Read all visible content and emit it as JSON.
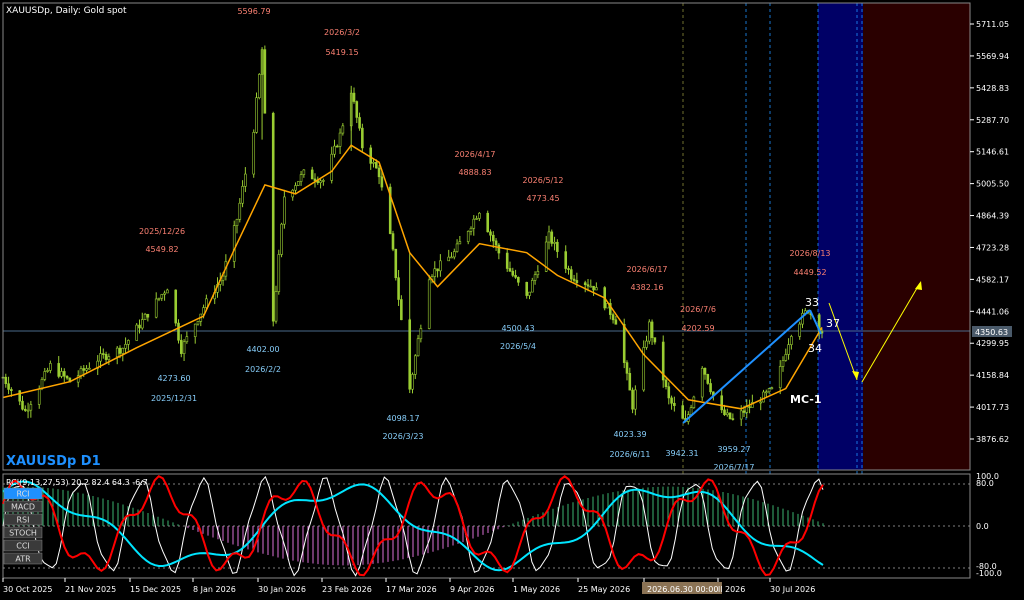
{
  "symbol_header": "XAUUSDp, Daily:  Gold spot",
  "symbol_big": "XAUUSDp D1",
  "current_price_label": "4350.63",
  "mc_label": "MC-1",
  "wave_labels": [
    "33",
    "34",
    "37"
  ],
  "indicator_header": "RCI(9,13,27,53) 20.2 82.4 64.3 -6.7",
  "indicator_buttons": [
    "RCI",
    "MACD",
    "RSI",
    "STOCH",
    "CCI",
    "ATR"
  ],
  "indicator_axis": [
    "100.0",
    "80.0",
    "0.0",
    "-80.0",
    "-100.0"
  ],
  "price_axis": [
    "5711.05",
    "5569.94",
    "5428.83",
    "5287.70",
    "5146.61",
    "5005.50",
    "4864.39",
    "4723.28",
    "4582.17",
    "4441.06",
    "4299.95",
    "4158.84",
    "4017.73",
    "3876.62"
  ],
  "date_axis": [
    "30 Oct 2025",
    "21 Nov 2025",
    "15 Dec 2025",
    "8 Jan 2026",
    "30 Jan 2026",
    "23 Feb 2026",
    "17 Mar 2026",
    "9 Apr 2026",
    "1 May 2026",
    "25 May 2026",
    "2026.06.30 00:00",
    "ll 2026",
    "30 Jul 2026"
  ],
  "annotations_high": [
    {
      "date": "",
      "price": "5596.79"
    },
    {
      "date": "2026/3/2",
      "price": "5419.15"
    },
    {
      "date": "2026/4/17",
      "price": "4888.83"
    },
    {
      "date": "2026/5/12",
      "price": "4773.45"
    },
    {
      "date": "2025/12/26",
      "price": "4549.82"
    },
    {
      "date": "2026/6/17",
      "price": "4382.16"
    },
    {
      "date": "2026/7/6",
      "price": "4202.59"
    },
    {
      "date": "2026/8/13",
      "price": "4449.52"
    }
  ],
  "annotations_low": [
    {
      "price": "4500.43",
      "date": "2026/5/4"
    },
    {
      "price": "4402.00",
      "date": "2026/2/2"
    },
    {
      "price": "4273.60",
      "date": "2025/12/31"
    },
    {
      "price": "4098.17",
      "date": "2026/3/23"
    },
    {
      "price": "4023.39",
      "date": "2026/6/11"
    },
    {
      "price": "3942.31",
      "date": ""
    },
    {
      "price": "3959.27",
      "date": "2026/7/17"
    }
  ],
  "colors": {
    "background": "#000000",
    "bull_candle": "#9ACD32",
    "ma_line": "#FFA500",
    "high_label": "#FA8072",
    "low_label": "#87CEFA",
    "channel": "#1E90FF",
    "projection": "#FFFF00",
    "zone_blue": "#000066",
    "zone_red": "#2a0000",
    "rci_red": "#FF0000",
    "rci_cyan": "#00E5FF",
    "rci_white": "#FFFFFF",
    "hist_pos": "#3CB371",
    "hist_neg": "#DA70D6"
  },
  "chart_data": {
    "type": "candlestick",
    "title": "XAUUSDp, Daily:  Gold spot",
    "x_range": [
      "2025-10-28",
      "2026-08-18"
    ],
    "ylim": [
      3800,
      5800
    ],
    "grid": false,
    "anchors": [
      {
        "date": "2025-10-28",
        "price": 4150
      },
      {
        "date": "2025-11-05",
        "price": 4000
      },
      {
        "date": "2025-11-14",
        "price": 4200
      },
      {
        "date": "2025-11-21",
        "price": 4130
      },
      {
        "date": "2025-12-01",
        "price": 4230
      },
      {
        "date": "2025-12-10",
        "price": 4280
      },
      {
        "date": "2025-12-26",
        "price": 4549.82
      },
      {
        "date": "2025-12-31",
        "price": 4273.6
      },
      {
        "date": "2026-01-08",
        "price": 4460
      },
      {
        "date": "2026-01-15",
        "price": 4600
      },
      {
        "date": "2026-01-20",
        "price": 4850
      },
      {
        "date": "2026-01-26",
        "price": 5250
      },
      {
        "date": "2026-01-29",
        "price": 5596.79
      },
      {
        "date": "2026-02-02",
        "price": 4402.0
      },
      {
        "date": "2026-02-06",
        "price": 4950
      },
      {
        "date": "2026-02-13",
        "price": 5050
      },
      {
        "date": "2026-02-20",
        "price": 5020
      },
      {
        "date": "2026-02-26",
        "price": 5220
      },
      {
        "date": "2026-03-02",
        "price": 5419.15
      },
      {
        "date": "2026-03-06",
        "price": 5170
      },
      {
        "date": "2026-03-12",
        "price": 5050
      },
      {
        "date": "2026-03-17",
        "price": 4700
      },
      {
        "date": "2026-03-23",
        "price": 4098.17
      },
      {
        "date": "2026-03-30",
        "price": 4600
      },
      {
        "date": "2026-04-08",
        "price": 4700
      },
      {
        "date": "2026-04-17",
        "price": 4888.83
      },
      {
        "date": "2026-04-24",
        "price": 4700
      },
      {
        "date": "2026-05-04",
        "price": 4500.43
      },
      {
        "date": "2026-05-12",
        "price": 4773.45
      },
      {
        "date": "2026-05-20",
        "price": 4600
      },
      {
        "date": "2026-05-28",
        "price": 4550
      },
      {
        "date": "2026-06-05",
        "price": 4400
      },
      {
        "date": "2026-06-11",
        "price": 4023.39
      },
      {
        "date": "2026-06-17",
        "price": 4382.16
      },
      {
        "date": "2026-06-24",
        "price": 4050
      },
      {
        "date": "2026-06-30",
        "price": 3942.31
      },
      {
        "date": "2026-07-06",
        "price": 4202.59
      },
      {
        "date": "2026-07-12",
        "price": 4000
      },
      {
        "date": "2026-07-17",
        "price": 3959.27
      },
      {
        "date": "2026-07-24",
        "price": 4030
      },
      {
        "date": "2026-08-01",
        "price": 4100
      },
      {
        "date": "2026-08-07",
        "price": 4350
      },
      {
        "date": "2026-08-13",
        "price": 4449.52
      },
      {
        "date": "2026-08-18",
        "price": 4350.63
      }
    ],
    "ma_series": [
      {
        "date": "2025-10-28",
        "price": 4060
      },
      {
        "date": "2025-11-21",
        "price": 4130
      },
      {
        "date": "2025-12-15",
        "price": 4280
      },
      {
        "date": "2026-01-08",
        "price": 4420
      },
      {
        "date": "2026-01-20",
        "price": 4740
      },
      {
        "date": "2026-01-30",
        "price": 5000
      },
      {
        "date": "2026-02-10",
        "price": 4960
      },
      {
        "date": "2026-02-23",
        "price": 5060
      },
      {
        "date": "2026-03-02",
        "price": 5175
      },
      {
        "date": "2026-03-12",
        "price": 5100
      },
      {
        "date": "2026-03-23",
        "price": 4700
      },
      {
        "date": "2026-04-02",
        "price": 4550
      },
      {
        "date": "2026-04-17",
        "price": 4740
      },
      {
        "date": "2026-05-04",
        "price": 4700
      },
      {
        "date": "2026-05-15",
        "price": 4600
      },
      {
        "date": "2026-06-01",
        "price": 4500
      },
      {
        "date": "2026-06-15",
        "price": 4250
      },
      {
        "date": "2026-07-01",
        "price": 4050
      },
      {
        "date": "2026-07-20",
        "price": 4010
      },
      {
        "date": "2026-08-05",
        "price": 4100
      },
      {
        "date": "2026-08-18",
        "price": 4370
      }
    ],
    "current_price": 4350.63,
    "rci": {
      "ylim": [
        -100,
        100
      ],
      "levels": [
        80,
        0,
        -80
      ],
      "values": [
        20.2,
        82.4,
        64.3,
        -6.7
      ]
    }
  }
}
